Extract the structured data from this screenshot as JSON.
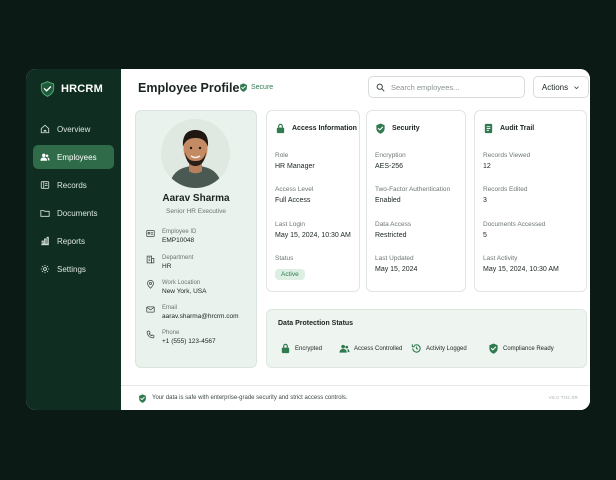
{
  "app": {
    "brand": "HRCRM"
  },
  "sidebar": {
    "items": [
      {
        "label": "Overview",
        "icon": "home-icon",
        "active": false
      },
      {
        "label": "Employees",
        "icon": "users-icon",
        "active": true
      },
      {
        "label": "Records",
        "icon": "records-icon",
        "active": false
      },
      {
        "label": "Documents",
        "icon": "folder-icon",
        "active": false
      },
      {
        "label": "Reports",
        "icon": "bar-chart-icon",
        "active": false
      },
      {
        "label": "Settings",
        "icon": "gear-icon",
        "active": false
      }
    ]
  },
  "header": {
    "title": "Employee Profile",
    "secure_label": "Secure",
    "search_placeholder": "Search employees...",
    "actions_label": "Actions"
  },
  "profile": {
    "name": "Aarav Sharma",
    "role": "Senior HR Executive",
    "details": [
      {
        "label": "Employee ID",
        "value": "EMP10048",
        "icon": "id-card-icon"
      },
      {
        "label": "Department",
        "value": "HR",
        "icon": "building-icon"
      },
      {
        "label": "Work Location",
        "value": "New York, USA",
        "icon": "location-pin-icon"
      },
      {
        "label": "Email",
        "value": "aarav.sharma@hrcrm.com",
        "icon": "mail-icon"
      },
      {
        "label": "Phone",
        "value": "+1 (555) 123-4567",
        "icon": "phone-icon"
      }
    ]
  },
  "access": {
    "title": "Access Information",
    "fields": [
      {
        "label": "Role",
        "value": "HR Manager"
      },
      {
        "label": "Access Level",
        "value": "Full Access"
      },
      {
        "label": "Last Login",
        "value": "May 15, 2024, 10:30 AM"
      },
      {
        "label": "Status",
        "value": "Active"
      }
    ]
  },
  "security": {
    "title": "Security",
    "fields": [
      {
        "label": "Encryption",
        "value": "AES-256"
      },
      {
        "label": "Two-Factor Authentication",
        "value": "Enabled"
      },
      {
        "label": "Data Access",
        "value": "Restricted"
      },
      {
        "label": "Last Updated",
        "value": "May 15, 2024"
      }
    ]
  },
  "audit": {
    "title": "Audit Trail",
    "fields": [
      {
        "label": "Records Viewed",
        "value": "12"
      },
      {
        "label": "Records Edited",
        "value": "3"
      },
      {
        "label": "Documents Accessed",
        "value": "5"
      },
      {
        "label": "Last Activity",
        "value": "May 15, 2024, 10:30 AM"
      }
    ]
  },
  "data_protection": {
    "title": "Data Protection Status",
    "items": [
      {
        "label": "Encrypted",
        "icon": "lock-icon"
      },
      {
        "label": "Access Controlled",
        "icon": "users-icon"
      },
      {
        "label": "Activity Logged",
        "icon": "history-icon"
      },
      {
        "label": "Compliance Ready",
        "icon": "shield-check-icon"
      }
    ]
  },
  "footer": {
    "text": "Your data is safe with enterprise-grade security and strict access controls.",
    "right_text": "V6.0  TH2.0R"
  },
  "colors": {
    "accent": "#2f7a4f",
    "sidebar": "#0f2d20",
    "active_nav": "#2f6b49"
  }
}
